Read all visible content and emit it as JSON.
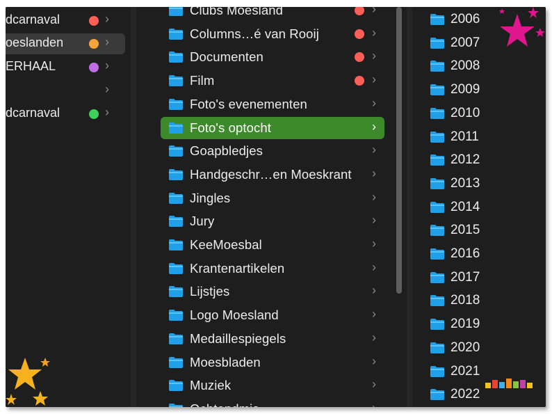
{
  "colors": {
    "red": "#ff5f57",
    "orange": "#f7a33a",
    "purple": "#c16ee6",
    "green": "#3fd05c",
    "selected_green": "#3c8a2a",
    "folder": "#1fa0e8"
  },
  "left_column": {
    "items": [
      {
        "label": "dcarnaval",
        "tag": "red"
      },
      {
        "label": "oeslanden",
        "tag": "orange"
      },
      {
        "label": "ERHAAL",
        "tag": "purple"
      },
      {
        "label": "",
        "tag": ""
      },
      {
        "label": "dcarnaval",
        "tag": "green"
      }
    ]
  },
  "middle_column": {
    "items": [
      {
        "label": "Clubs Moesland",
        "tag": "red"
      },
      {
        "label": "Columns…é van Rooij",
        "tag": "red"
      },
      {
        "label": "Documenten",
        "tag": "red"
      },
      {
        "label": "Film",
        "tag": "red"
      },
      {
        "label": "Foto's evenementen",
        "tag": ""
      },
      {
        "label": "Foto's optocht",
        "tag": "",
        "selected": true
      },
      {
        "label": "Goapbledjes",
        "tag": ""
      },
      {
        "label": "Handgeschr…en Moeskrant",
        "tag": ""
      },
      {
        "label": "Jingles",
        "tag": ""
      },
      {
        "label": "Jury",
        "tag": ""
      },
      {
        "label": "KeeMoesbal",
        "tag": ""
      },
      {
        "label": "Krantenartikelen",
        "tag": ""
      },
      {
        "label": "Lijstjes",
        "tag": ""
      },
      {
        "label": "Logo Moesland",
        "tag": ""
      },
      {
        "label": "Medaillespiegels",
        "tag": ""
      },
      {
        "label": "Moesbladen",
        "tag": ""
      },
      {
        "label": "Muziek",
        "tag": ""
      },
      {
        "label": "Ochtendmis",
        "tag": ""
      }
    ]
  },
  "right_column": {
    "items": [
      "2006",
      "2007",
      "2008",
      "2009",
      "2010",
      "2011",
      "2012",
      "2013",
      "2014",
      "2015",
      "2016",
      "2017",
      "2018",
      "2019",
      "2020",
      "2021",
      "2022"
    ]
  }
}
